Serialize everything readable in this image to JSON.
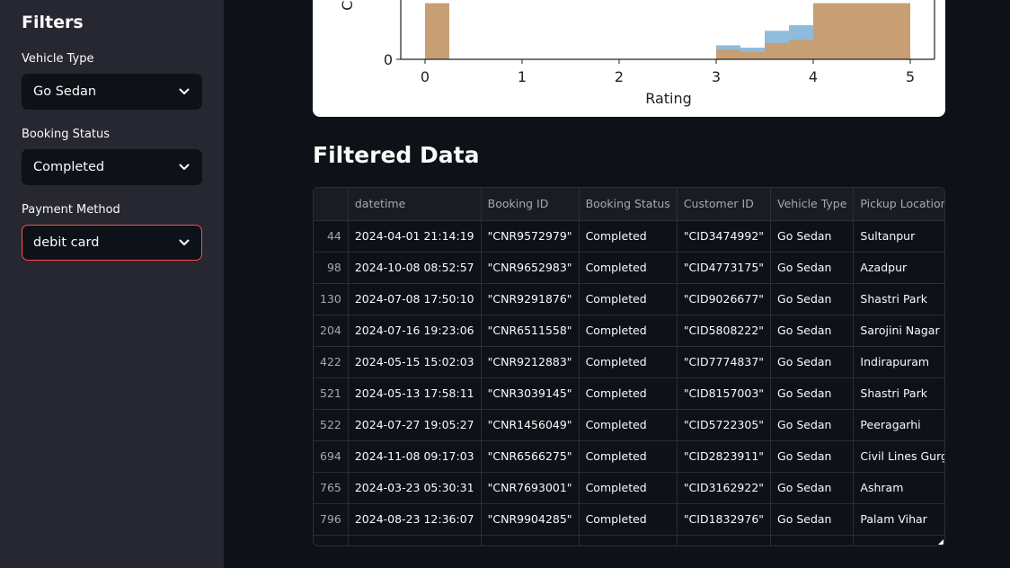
{
  "sidebar": {
    "title": "Filters",
    "filters": [
      {
        "label": "Vehicle Type",
        "value": "Go Sedan"
      },
      {
        "label": "Booking Status",
        "value": "Completed"
      },
      {
        "label": "Payment Method",
        "value": "debit card"
      }
    ]
  },
  "colors": {
    "accent": "#ff4b4b",
    "sidebar_bg": "#262730",
    "page_bg": "#0e1117",
    "series_blue": "#8fbcdc",
    "series_tan": "#c89e75"
  },
  "chart_data": {
    "type": "bar",
    "xlabel": "Rating",
    "ylabel": "Count",
    "xlim": [
      -0.25,
      5.25
    ],
    "x_ticks": [
      "0",
      "1",
      "2",
      "3",
      "4",
      "5"
    ],
    "y_tick_visible": "0",
    "bin_width": 0.25,
    "series": [
      {
        "name": "",
        "color": "#8fbcdc",
        "bins": [
          {
            "x": 0.0,
            "v": 1.0
          },
          {
            "x": 3.0,
            "v": 0.6
          },
          {
            "x": 3.25,
            "v": 0.5
          },
          {
            "x": 3.5,
            "v": 1.22
          },
          {
            "x": 3.75,
            "v": 1.46
          },
          {
            "x": 4.0,
            "v": 2.4
          },
          {
            "x": 4.25,
            "v": 2.4
          },
          {
            "x": 4.5,
            "v": 2.4
          },
          {
            "x": 4.75,
            "v": 2.4
          }
        ]
      },
      {
        "name": "",
        "color": "#c89e75",
        "bins": [
          {
            "x": 0.0,
            "v": 2.4
          },
          {
            "x": 3.0,
            "v": 0.42
          },
          {
            "x": 3.25,
            "v": 0.32
          },
          {
            "x": 3.5,
            "v": 0.7
          },
          {
            "x": 3.75,
            "v": 0.84
          },
          {
            "x": 4.0,
            "v": 2.4
          },
          {
            "x": 4.25,
            "v": 2.4
          },
          {
            "x": 4.5,
            "v": 2.4
          },
          {
            "x": 4.75,
            "v": 2.4
          }
        ]
      }
    ]
  },
  "main": {
    "section_title": "Filtered Data"
  },
  "table": {
    "columns": [
      "",
      "datetime",
      "Booking ID",
      "Booking Status",
      "Customer ID",
      "Vehicle Type",
      "Pickup Location"
    ],
    "rows": [
      [
        "44",
        "2024-04-01 21:14:19",
        "\"CNR9572979\"",
        "Completed",
        "\"CID3474992\"",
        "Go Sedan",
        "Sultanpur"
      ],
      [
        "98",
        "2024-10-08 08:52:57",
        "\"CNR9652983\"",
        "Completed",
        "\"CID4773175\"",
        "Go Sedan",
        "Azadpur"
      ],
      [
        "130",
        "2024-07-08 17:50:10",
        "\"CNR9291876\"",
        "Completed",
        "\"CID9026677\"",
        "Go Sedan",
        "Shastri Park"
      ],
      [
        "204",
        "2024-07-16 19:23:06",
        "\"CNR6511558\"",
        "Completed",
        "\"CID5808222\"",
        "Go Sedan",
        "Sarojini Nagar"
      ],
      [
        "422",
        "2024-05-15 15:02:03",
        "\"CNR9212883\"",
        "Completed",
        "\"CID7774837\"",
        "Go Sedan",
        "Indirapuram"
      ],
      [
        "521",
        "2024-05-13 17:58:11",
        "\"CNR3039145\"",
        "Completed",
        "\"CID8157003\"",
        "Go Sedan",
        "Shastri Park"
      ],
      [
        "522",
        "2024-07-27 19:05:27",
        "\"CNR1456049\"",
        "Completed",
        "\"CID5722305\"",
        "Go Sedan",
        "Peeragarhi"
      ],
      [
        "694",
        "2024-11-08 09:17:03",
        "\"CNR6566275\"",
        "Completed",
        "\"CID2823911\"",
        "Go Sedan",
        "Civil Lines Gurgaon"
      ],
      [
        "765",
        "2024-03-23 05:30:31",
        "\"CNR7693001\"",
        "Completed",
        "\"CID3162922\"",
        "Go Sedan",
        "Ashram"
      ],
      [
        "796",
        "2024-08-23 12:36:07",
        "\"CNR9904285\"",
        "Completed",
        "\"CID1832976\"",
        "Go Sedan",
        "Palam Vihar"
      ]
    ]
  }
}
